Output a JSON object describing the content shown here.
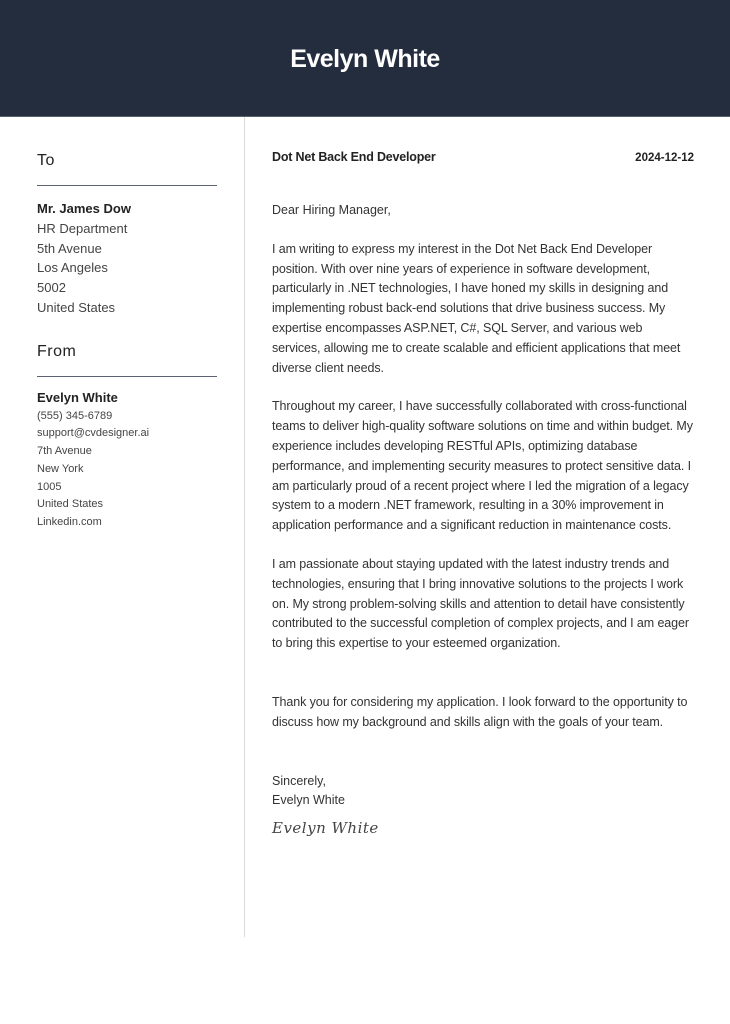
{
  "header": {
    "name": "Evelyn White"
  },
  "recipient": {
    "section_title": "To",
    "name": "Mr. James Dow",
    "lines": [
      "HR Department",
      "5th Avenue",
      "Los Angeles",
      "5002",
      "United States"
    ]
  },
  "sender": {
    "section_title": "From",
    "name": "Evelyn White",
    "lines": [
      "(555) 345-6789",
      "support@cvdesigner.ai",
      "7th Avenue",
      "New York",
      "1005",
      "United States",
      "Linkedin.com"
    ]
  },
  "letter": {
    "job_title": "Dot Net Back End Developer",
    "date": "2024-12-12",
    "salutation": "Dear Hiring Manager,",
    "paragraphs": [
      "I am writing to express my interest in the Dot Net Back End Developer position. With over nine years of experience in software development, particularly in .NET technologies, I have honed my skills in designing and implementing robust back-end solutions that drive business success. My expertise encompasses ASP.NET, C#, SQL Server, and various web services, allowing me to create scalable and efficient applications that meet diverse client needs.",
      "Throughout my career, I have successfully collaborated with cross-functional teams to deliver high-quality software solutions on time and within budget. My experience includes developing RESTful APIs, optimizing database performance, and implementing security measures to protect sensitive data. I am particularly proud of a recent project where I led the migration of a legacy system to a modern .NET framework, resulting in a 30% improvement in application performance and a significant reduction in maintenance costs.",
      "I am passionate about staying updated with the latest industry trends and technologies, ensuring that I bring innovative solutions to the projects I work on. My strong problem-solving skills and attention to detail have consistently contributed to the successful completion of complex projects, and I am eager to bring this expertise to your esteemed organization.",
      "Thank you for considering my application. I look forward to the opportunity to discuss how my background and skills align with the goals of your team."
    ],
    "closing": "Sincerely,",
    "closing_name": "Evelyn White",
    "signature": "Evelyn White"
  }
}
